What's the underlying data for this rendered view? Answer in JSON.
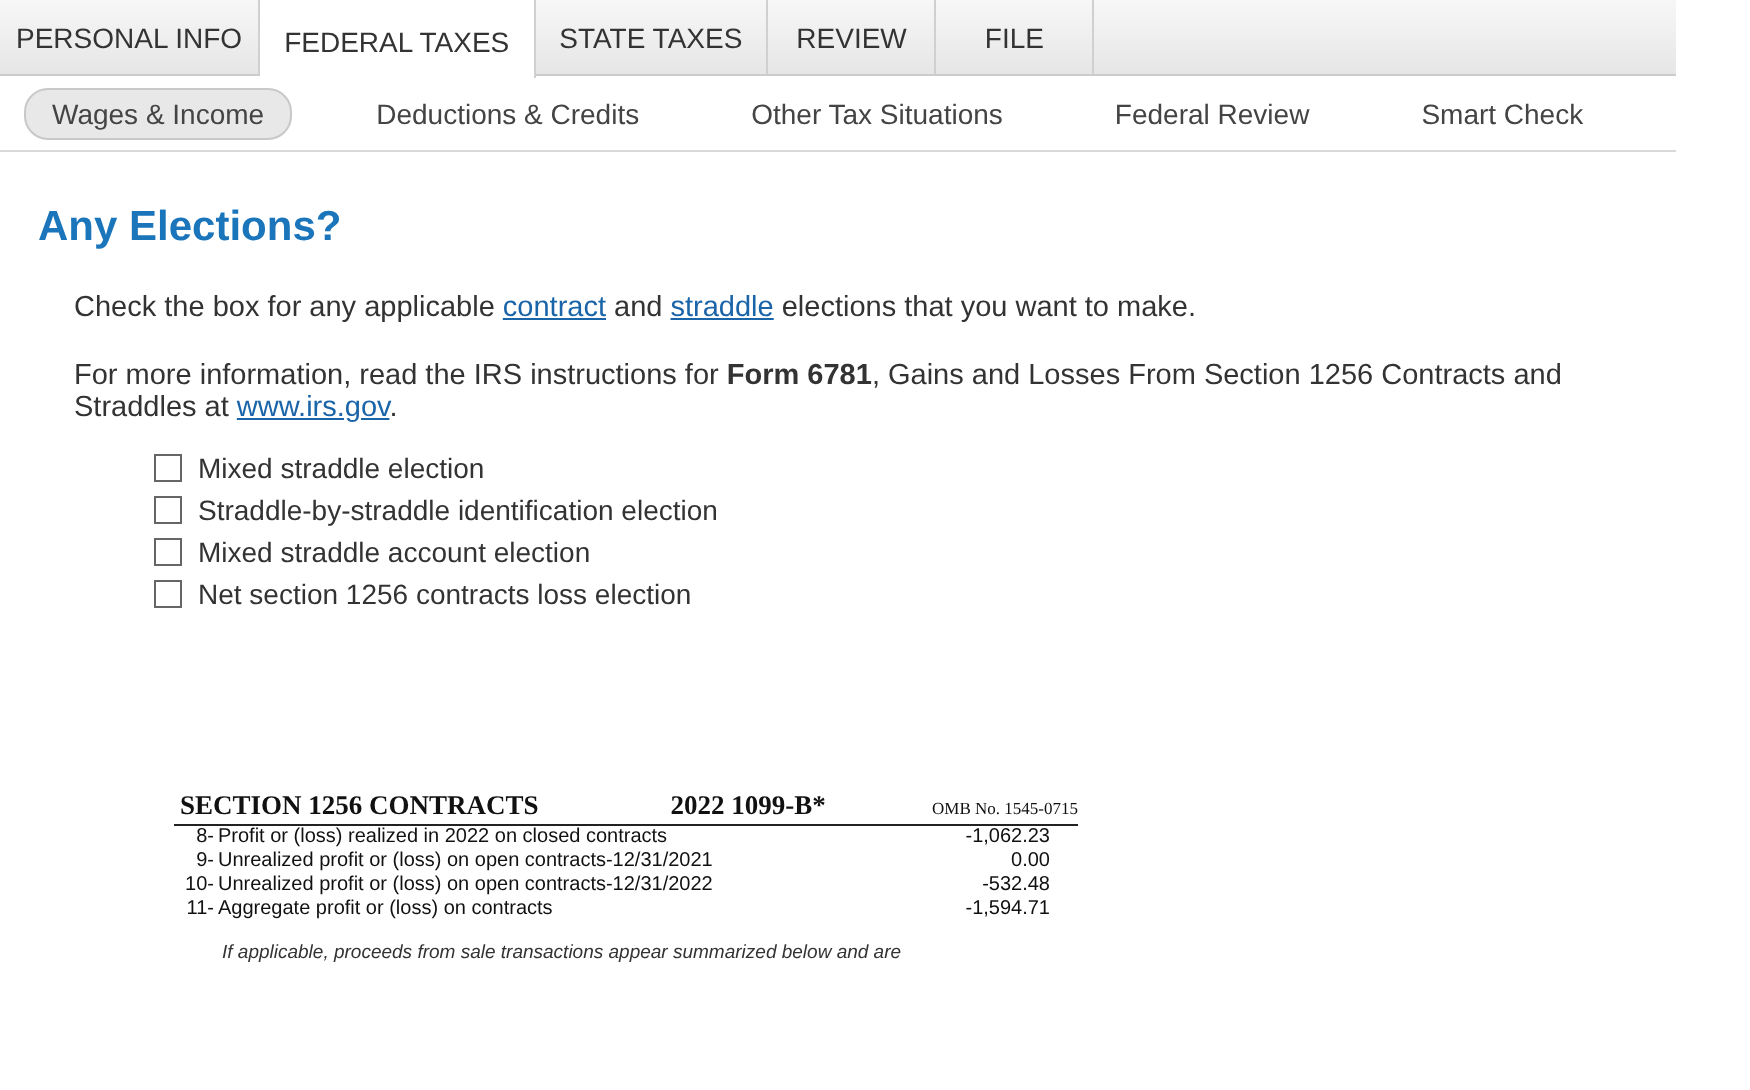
{
  "tabs": [
    {
      "label": "PERSONAL INFO",
      "selected": false
    },
    {
      "label": "FEDERAL TAXES",
      "selected": true
    },
    {
      "label": "STATE TAXES",
      "selected": false
    },
    {
      "label": "REVIEW",
      "selected": false
    },
    {
      "label": "FILE",
      "selected": false
    }
  ],
  "subnav": [
    {
      "label": "Wages & Income",
      "selected": true
    },
    {
      "label": "Deductions & Credits",
      "selected": false
    },
    {
      "label": "Other Tax Situations",
      "selected": false
    },
    {
      "label": "Federal Review",
      "selected": false
    },
    {
      "label": "Smart Check",
      "selected": false
    }
  ],
  "heading": "Any Elections?",
  "paragraphs": [
    [
      {
        "kind": "text",
        "text": "Check the box for any applicable "
      },
      {
        "kind": "link",
        "text": "contract"
      },
      {
        "kind": "text",
        "text": " and "
      },
      {
        "kind": "link",
        "text": "straddle"
      },
      {
        "kind": "text",
        "text": " elections that you want to make."
      }
    ],
    [
      {
        "kind": "text",
        "text": "For more information, read the IRS instructions for **Form 6781**, Gains and Losses From Section 1256 Contracts and Straddles at "
      },
      {
        "kind": "link",
        "text": " www.irs.gov"
      },
      {
        "kind": "text",
        "text": "."
      }
    ]
  ],
  "elections": [
    {
      "label": "Mixed straddle election",
      "checked": false
    },
    {
      "label": "Straddle-by-straddle identification election",
      "checked": false
    },
    {
      "label": "Mixed straddle account election",
      "checked": false
    },
    {
      "label": "Net section 1256 contracts loss election",
      "checked": false
    }
  ],
  "form_image": {
    "title": "SECTION 1256 CONTRACTS",
    "form": "2022 1099-B*",
    "omb": "OMB No. 1545-0715",
    "rows": [
      {
        "number": "8-",
        "label": "Profit or (loss) realized in 2022 on closed contracts",
        "amount": "-1,062.23"
      },
      {
        "number": "9-",
        "label": "Unrealized profit or (loss) on open contracts-12/31/2021",
        "amount": "0.00"
      },
      {
        "number": "10-",
        "label": "Unrealized profit or (loss) on open contracts-12/31/2022",
        "amount": "-532.48"
      },
      {
        "number": "11-",
        "label": "Aggregate profit or (loss) on contracts",
        "amount": "-1,594.71"
      }
    ],
    "note": "If applicable, proceeds from sale transactions appear summarized below and are"
  }
}
